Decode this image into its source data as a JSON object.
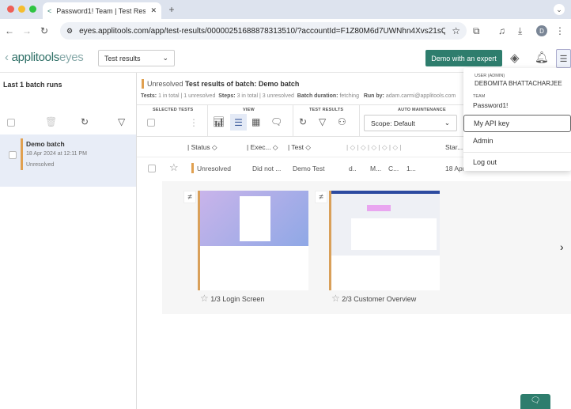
{
  "browser": {
    "tab_title": "Password1! Team | Test Results",
    "url": "eyes.applitools.com/app/test-results/00000251688878313510/?accountId=F1Z80M6d7UWNhn4Xvs21sQ__",
    "profile_initial": "D"
  },
  "header": {
    "logo_main": "applitools",
    "logo_sub": "eyes",
    "view_select": "Test results",
    "demo_button": "Demo with an expert"
  },
  "left": {
    "title": "Last 1 batch runs",
    "batch": {
      "name": "Demo batch",
      "date": "18 Apr 2024 at 12:11 PM",
      "status": "Unresolved"
    }
  },
  "batch_header": {
    "status": "Unresolved",
    "title_prefix": "Test results of batch:",
    "title": "Demo batch",
    "tests_label": "Tests:",
    "tests_total": "1 in total",
    "tests_unresolved": "1 unresolved",
    "steps_label": "Steps:",
    "steps_total": "3 in total",
    "steps_unresolved": "3 unresolved",
    "duration_label": "Batch duration:",
    "duration": "fetching",
    "runby_label": "Run by:",
    "runby": "adam.carmi@applitools.com"
  },
  "toolbar": {
    "selected_tests": "SELECTED TESTS",
    "view": "VIEW",
    "test_results": "TEST RESULTS",
    "auto_maintenance": "AUTO MAINTENANCE",
    "scope": "Scope: Default"
  },
  "table": {
    "columns": [
      "Status",
      "Exec...",
      "Test",
      "Star..."
    ],
    "row": {
      "status": "Unresolved",
      "exec": "Did not ...",
      "test": "Demo Test",
      "c1": "d..",
      "c2": "M...",
      "c3": "C...",
      "c4": "1...",
      "start": "18 Apr"
    }
  },
  "steps": [
    {
      "label": "1/3 Login Screen"
    },
    {
      "label": "2/3 Customer Overview"
    }
  ],
  "user_menu": {
    "user_label": "USER (ADMIN)",
    "user_name": "DEBOMITA BHATTACHARJEE",
    "team_label": "TEAM",
    "team_name": "Password1!",
    "items": [
      "My API key",
      "Admin",
      "Log out"
    ]
  },
  "colors": {
    "brand": "#2e7d6d",
    "unresolved": "#e0a050"
  }
}
